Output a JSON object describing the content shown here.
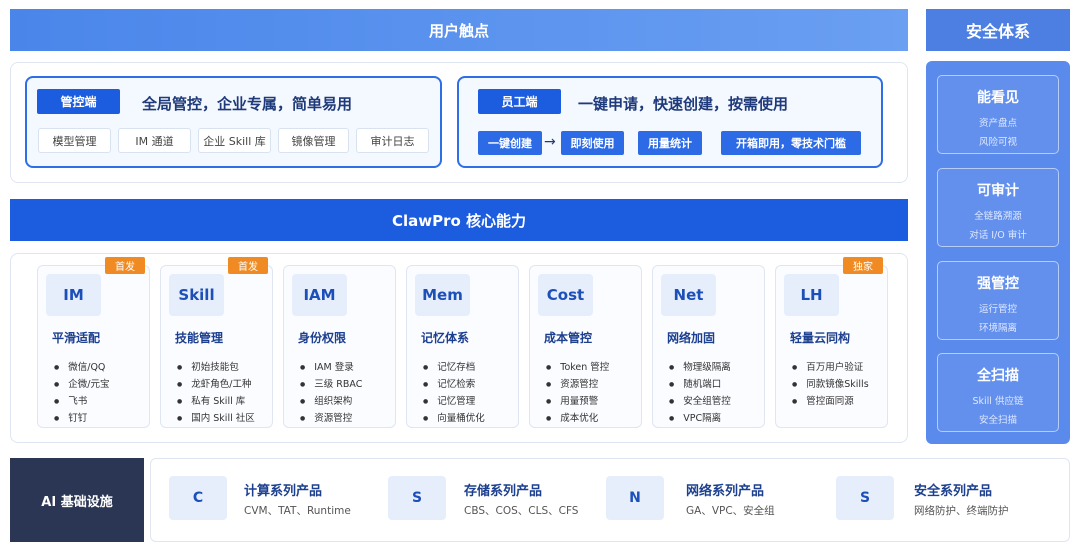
{
  "header": {
    "user_touchpoints": "用户触点",
    "security_system": "安全体系"
  },
  "admin_portal": {
    "tag": "管控端",
    "slogan": "全局管控，企业专属，简单易用",
    "modules": [
      "模型管理",
      "IM 通道",
      "企业 Skill 库",
      "镜像管理",
      "审计日志"
    ]
  },
  "staff_portal": {
    "tag": "员工端",
    "slogan": "一键申请，快速创建，按需使用",
    "steps": [
      "一键创建",
      "即刻使用",
      "用量统计",
      "开箱即用，零技术门槛"
    ],
    "arrow": "→"
  },
  "core": {
    "title": "ClawPro 核心能力",
    "cards": [
      {
        "code": "IM",
        "badge": "首发",
        "title": "平滑适配",
        "items": [
          "微信/QQ",
          "企微/元宝",
          "飞书",
          "钉钉"
        ]
      },
      {
        "code": "Skill",
        "badge": "首发",
        "title": "技能管理",
        "items": [
          "初始技能包",
          "龙虾角色/工种",
          "私有 Skill 库",
          "国内 Skill 社区"
        ]
      },
      {
        "code": "IAM",
        "badge": "",
        "title": "身份权限",
        "items": [
          "IAM 登录",
          "三级 RBAC",
          "组织架构",
          "资源管控"
        ]
      },
      {
        "code": "Mem",
        "badge": "",
        "title": "记忆体系",
        "items": [
          "记忆存档",
          "记忆检索",
          "记忆管理",
          "向量桶优化"
        ]
      },
      {
        "code": "Cost",
        "badge": "",
        "title": "成本管控",
        "items": [
          "Token 管控",
          "资源管控",
          "用量预警",
          "成本优化"
        ]
      },
      {
        "code": "Net",
        "badge": "",
        "title": "网络加固",
        "items": [
          "物理级隔离",
          "随机端口",
          "安全组管控",
          "VPC隔离"
        ]
      },
      {
        "code": "LH",
        "badge": "独家",
        "title": "轻量云同构",
        "items": [
          "百万用户验证",
          "同款镜像Skills",
          "管控面同源"
        ]
      }
    ]
  },
  "security": [
    {
      "title": "能看见",
      "lines": [
        "资产盘点",
        "风险可视"
      ]
    },
    {
      "title": "可审计",
      "lines": [
        "全链路溯源",
        "对话 I/O 审计"
      ]
    },
    {
      "title": "强管控",
      "lines": [
        "运行管控",
        "环境隔离"
      ]
    },
    {
      "title": "全扫描",
      "lines": [
        "Skill 供应链",
        "安全扫描"
      ]
    }
  ],
  "infra": {
    "label": "AI 基础设施",
    "products": [
      {
        "code": "C",
        "title": "计算系列产品",
        "sub": "CVM、TAT、Runtime"
      },
      {
        "code": "S",
        "title": "存储系列产品",
        "sub": "CBS、COS、CLS、CFS"
      },
      {
        "code": "N",
        "title": "网络系列产品",
        "sub": "GA、VPC、安全组"
      },
      {
        "code": "S",
        "title": "安全系列产品",
        "sub": "网络防护、终端防护"
      }
    ]
  },
  "colors": {
    "primary": "#1c5cde",
    "accent": "#ef8b22",
    "infra_dark": "#2b3654",
    "security_bg": "#5a8aec"
  }
}
